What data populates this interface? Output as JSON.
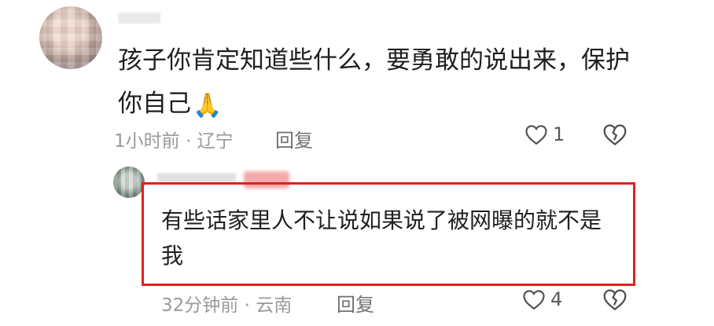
{
  "comment": {
    "text_line1": "孩子你肯定知道些什么，要勇敢的说出来，保护",
    "text_line2": "你自己",
    "emoji": "🙏",
    "meta": "1小时前 · 辽宁",
    "reply_label": "回复",
    "like_count": "1",
    "icons": {
      "like": "heart-outline-icon",
      "dislike": "broken-heart-icon"
    }
  },
  "reply": {
    "text": "有些话家里人不让说如果说了被网曝的就不是我",
    "meta": "32分钟前 · 云南",
    "reply_label": "回复",
    "like_count": "4",
    "highlight_color": "#e02020"
  }
}
